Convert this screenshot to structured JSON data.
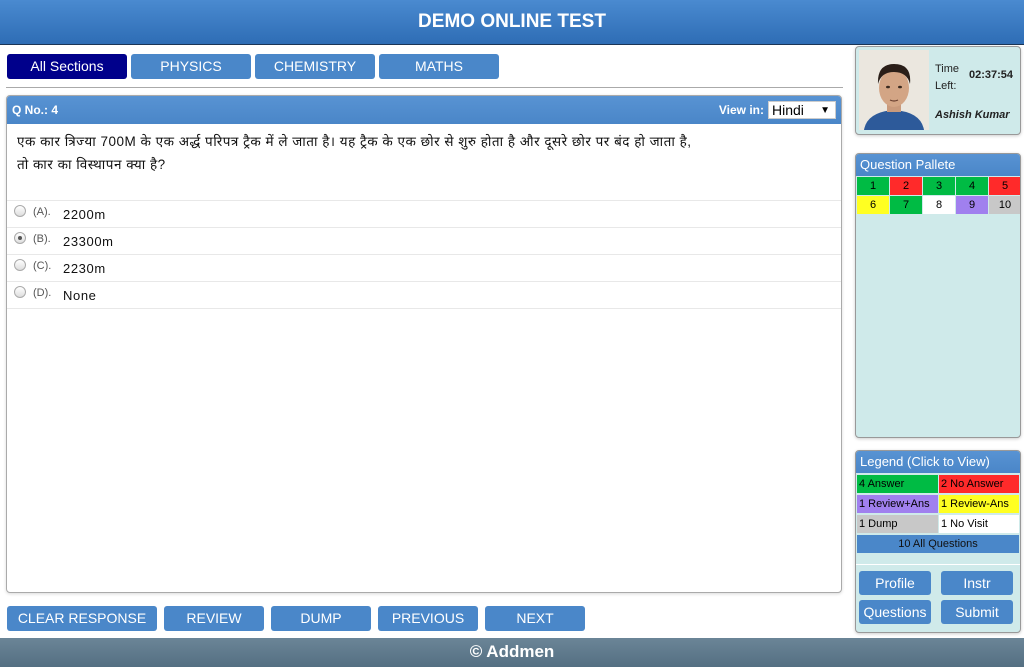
{
  "header": {
    "title": "DEMO ONLINE TEST"
  },
  "sections": [
    {
      "label": "All Sections",
      "active": true
    },
    {
      "label": "PHYSICS",
      "active": false
    },
    {
      "label": "CHEMISTRY",
      "active": false
    },
    {
      "label": "MATHS",
      "active": false
    }
  ],
  "question": {
    "number_label": "Q No.: 4",
    "view_in_label": "View in:",
    "language": "Hindi",
    "text_line1": "एक कार त्रिज्या 700M के एक अर्द्ध परिपत्र ट्रैक में ले जाता है। यह ट्रैक के एक छोर से शुरु होता है और दूसरे छोर पर बंद हो जाता है,",
    "text_line2": "तो कार का विस्थापन क्या है?",
    "options": [
      {
        "label": "(A).",
        "text": "2200m",
        "selected": false
      },
      {
        "label": "(B).",
        "text": "23300m",
        "selected": true
      },
      {
        "label": "(C).",
        "text": "2230m",
        "selected": false
      },
      {
        "label": "(D).",
        "text": "None",
        "selected": false
      }
    ]
  },
  "actions": {
    "clear": "CLEAR RESPONSE",
    "review": "REVIEW",
    "dump": "DUMP",
    "previous": "PREVIOUS",
    "next": "NEXT"
  },
  "profile": {
    "time_label_1": "Time",
    "time_label_2": "Left:",
    "time_left": "02:37:54",
    "name": "Ashish Kumar"
  },
  "palette": {
    "title": "Question Pallete",
    "questions": [
      {
        "num": "1",
        "color": "#00bb44"
      },
      {
        "num": "2",
        "color": "#ff2a2a"
      },
      {
        "num": "3",
        "color": "#00bb44"
      },
      {
        "num": "4",
        "color": "#00bb44"
      },
      {
        "num": "5",
        "color": "#ff2a2a"
      },
      {
        "num": "6",
        "color": "#ffff22"
      },
      {
        "num": "7",
        "color": "#00bb44"
      },
      {
        "num": "8",
        "color": "#ffffff"
      },
      {
        "num": "9",
        "color": "#a080ee"
      },
      {
        "num": "10",
        "color": "#c8c8c8"
      }
    ]
  },
  "legend": {
    "title": "Legend (Click to View)",
    "items": [
      {
        "text": "4 Answer",
        "color": "#00bb44"
      },
      {
        "text": "2 No Answer",
        "color": "#ff2a2a"
      },
      {
        "text": "1 Review+Ans",
        "color": "#a080ee"
      },
      {
        "text": "1 Review-Ans",
        "color": "#ffff22"
      },
      {
        "text": "1 Dump",
        "color": "#c8c8c8"
      },
      {
        "text": "1 No Visit",
        "color": "#ffffff"
      }
    ],
    "all": "10 All Questions"
  },
  "side_buttons": {
    "profile": "Profile",
    "instr": "Instr",
    "questions": "Questions",
    "submit": "Submit"
  },
  "footer": {
    "text": "© Addmen"
  }
}
